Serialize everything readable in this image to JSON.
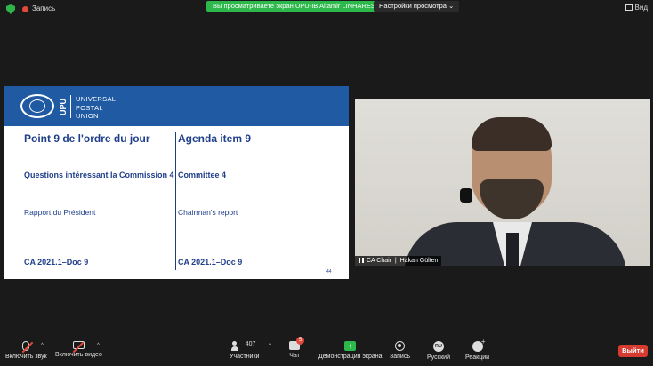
{
  "topbar": {
    "recording_label": "Запись",
    "share_banner": "Вы просматриваете экран UPU-IB Altamir LINHARES",
    "view_options": "Настройки просмотра ⌄",
    "view_button": "Вид"
  },
  "slide": {
    "logo_abbr": "UPU",
    "logo_line1": "UNIVERSAL",
    "logo_line2": "POSTAL",
    "logo_line3": "UNION",
    "left": {
      "title": "Point 9 de l'ordre du jour",
      "subtitle": "Questions intéressant la Commission 4",
      "report": "Rapport du Président",
      "doc": "CA 2021.1–Doc 9"
    },
    "right": {
      "title": "Agenda item 9",
      "subtitle": "Committee 4",
      "report": "Chairman's report",
      "doc": "CA 2021.1–Doc 9"
    },
    "page_number": "44"
  },
  "video": {
    "role": "CA Chair",
    "name": "Hakan Gülten"
  },
  "toolbar": {
    "mute_label": "Включить звук",
    "video_label": "Включить видео",
    "participants_label": "Участники",
    "participants_count": "407",
    "chat_label": "Чат",
    "chat_badge": "5",
    "share_label": "Демонстрация экрана",
    "record_label": "Запись",
    "language_code": "RU",
    "language_label": "Русский",
    "reactions_label": "Реакции",
    "leave_label": "Выйти"
  },
  "colors": {
    "accent_green": "#2db84c",
    "leave_red": "#d63b30",
    "upu_blue": "#1f5aa3"
  }
}
